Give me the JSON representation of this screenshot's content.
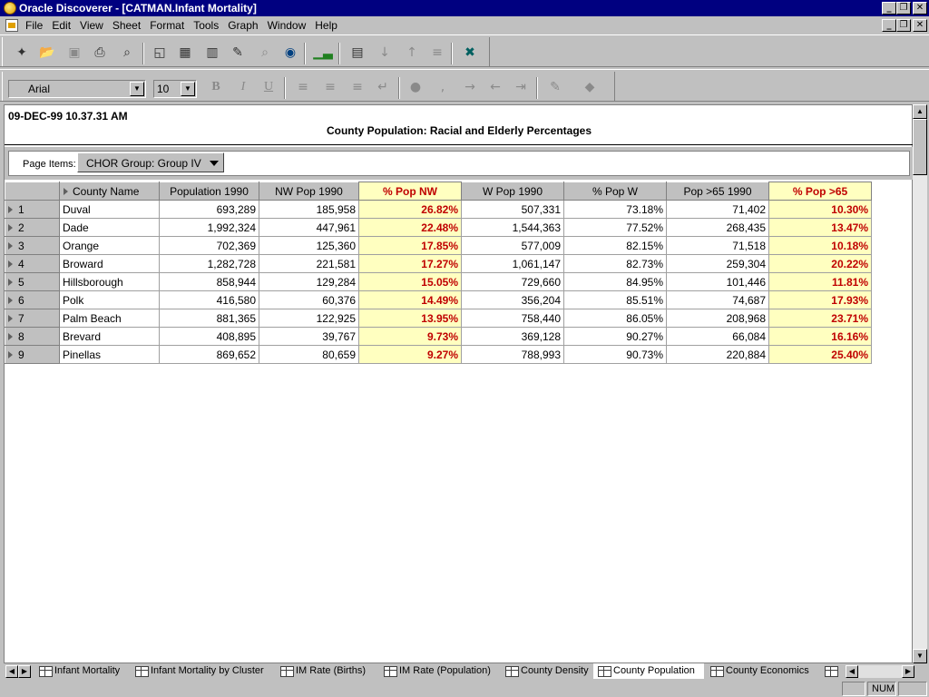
{
  "window": {
    "title": "Oracle Discoverer - [CATMAN.Infant Mortality]"
  },
  "menu": [
    {
      "label": "File",
      "name": "menu-file"
    },
    {
      "label": "Edit",
      "name": "menu-edit"
    },
    {
      "label": "View",
      "name": "menu-view"
    },
    {
      "label": "Sheet",
      "name": "menu-sheet"
    },
    {
      "label": "Format",
      "name": "menu-format"
    },
    {
      "label": "Tools",
      "name": "menu-tools"
    },
    {
      "label": "Graph",
      "name": "menu-graph"
    },
    {
      "label": "Window",
      "name": "menu-window"
    },
    {
      "label": "Help",
      "name": "menu-help"
    }
  ],
  "format_toolbar": {
    "font": "Arial",
    "size": "10",
    "bold": "B",
    "italic": "I",
    "underline": "U"
  },
  "sheet": {
    "timestamp": "09-DEC-99  10.37.31 AM",
    "title": "County Population: Racial and Elderly Percentages",
    "page_items_label": "Page Items:",
    "page_item_value": "CHOR Group: Group IV"
  },
  "table": {
    "columns": [
      "County Name",
      "Population 1990",
      "NW Pop 1990",
      "% Pop NW",
      "W Pop 1990",
      "% Pop W",
      "Pop >65 1990",
      "% Pop >65"
    ],
    "rows": [
      {
        "n": "1",
        "cells": [
          "Duval",
          "693,289",
          "185,958",
          "26.82%",
          "507,331",
          "73.18%",
          "71,402",
          "10.30%"
        ]
      },
      {
        "n": "2",
        "cells": [
          "Dade",
          "1,992,324",
          "447,961",
          "22.48%",
          "1,544,363",
          "77.52%",
          "268,435",
          "13.47%"
        ]
      },
      {
        "n": "3",
        "cells": [
          "Orange",
          "702,369",
          "125,360",
          "17.85%",
          "577,009",
          "82.15%",
          "71,518",
          "10.18%"
        ]
      },
      {
        "n": "4",
        "cells": [
          "Broward",
          "1,282,728",
          "221,581",
          "17.27%",
          "1,061,147",
          "82.73%",
          "259,304",
          "20.22%"
        ]
      },
      {
        "n": "5",
        "cells": [
          "Hillsborough",
          "858,944",
          "129,284",
          "15.05%",
          "729,660",
          "84.95%",
          "101,446",
          "11.81%"
        ]
      },
      {
        "n": "6",
        "cells": [
          "Polk",
          "416,580",
          "60,376",
          "14.49%",
          "356,204",
          "85.51%",
          "74,687",
          "17.93%"
        ]
      },
      {
        "n": "7",
        "cells": [
          "Palm Beach",
          "881,365",
          "122,925",
          "13.95%",
          "758,440",
          "86.05%",
          "208,968",
          "23.71%"
        ]
      },
      {
        "n": "8",
        "cells": [
          "Brevard",
          "408,895",
          "39,767",
          "9.73%",
          "369,128",
          "90.27%",
          "66,084",
          "16.16%"
        ]
      },
      {
        "n": "9",
        "cells": [
          "Pinellas",
          "869,652",
          "80,659",
          "9.27%",
          "788,993",
          "90.73%",
          "220,884",
          "25.40%"
        ]
      }
    ]
  },
  "tabs": [
    {
      "label": "Infant Mortality",
      "active": false
    },
    {
      "label": "Infant Mortality by Cluster",
      "active": false
    },
    {
      "label": "IM Rate (Births)",
      "active": false
    },
    {
      "label": "IM Rate (Population)",
      "active": false
    },
    {
      "label": "County Density",
      "active": false
    },
    {
      "label": "County Population",
      "active": true
    },
    {
      "label": "County Economics",
      "active": false
    }
  ],
  "status": {
    "num": "NUM"
  },
  "colors": {
    "title_bar": "#000080",
    "highlight_bg": "#ffffc0",
    "highlight_text": "#c00000"
  }
}
